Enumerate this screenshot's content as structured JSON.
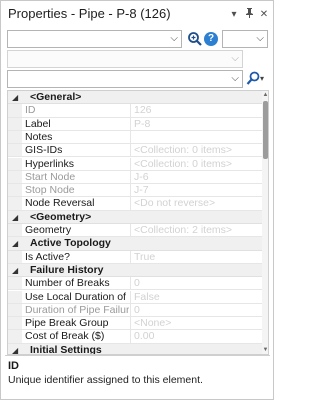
{
  "window": {
    "title": "Properties - Pipe - P-8 (126)",
    "icons": [
      "pin-icon",
      "maximize-icon",
      "close-icon"
    ]
  },
  "toolbar": {
    "element_selector_value": "",
    "small_selector_value": "",
    "disabled_selector_value": "",
    "filter_value": ""
  },
  "properties": {
    "categories": {
      "general": "<General>",
      "geometry": "<Geometry>",
      "active_topology": "Active Topology",
      "failure_history": "Failure History",
      "initial_settings": "Initial Settings"
    },
    "rows": {
      "id": {
        "label": "ID",
        "value": "126"
      },
      "label": {
        "label": "Label",
        "value": "P-8"
      },
      "notes": {
        "label": "Notes",
        "value": ""
      },
      "gis_ids": {
        "label": "GIS-IDs",
        "value": "<Collection: 0 items>"
      },
      "hyperlinks": {
        "label": "Hyperlinks",
        "value": "<Collection: 0 items>"
      },
      "start_node": {
        "label": "Start Node",
        "value": "J-6"
      },
      "stop_node": {
        "label": "Stop Node",
        "value": "J-7"
      },
      "node_reversal": {
        "label": "Node Reversal",
        "value": "<Do not reverse>"
      },
      "geometry": {
        "label": "Geometry",
        "value": "<Collection: 2 items>"
      },
      "is_active": {
        "label": "Is Active?",
        "value": "True"
      },
      "number_of_breaks": {
        "label": "Number of Breaks",
        "value": "0"
      },
      "use_local_duration": {
        "label": "Use Local Duration of Pipe Failure History?",
        "value": "False"
      },
      "duration_history": {
        "label": "Duration of Pipe Failure History",
        "value": "0"
      },
      "pipe_break_group": {
        "label": "Pipe Break Group",
        "value": "<None>"
      },
      "cost_of_break": {
        "label": "Cost of Break ($)",
        "value": "0.00"
      }
    }
  },
  "description": {
    "title": "ID",
    "text": "Unique identifier assigned to this element."
  }
}
